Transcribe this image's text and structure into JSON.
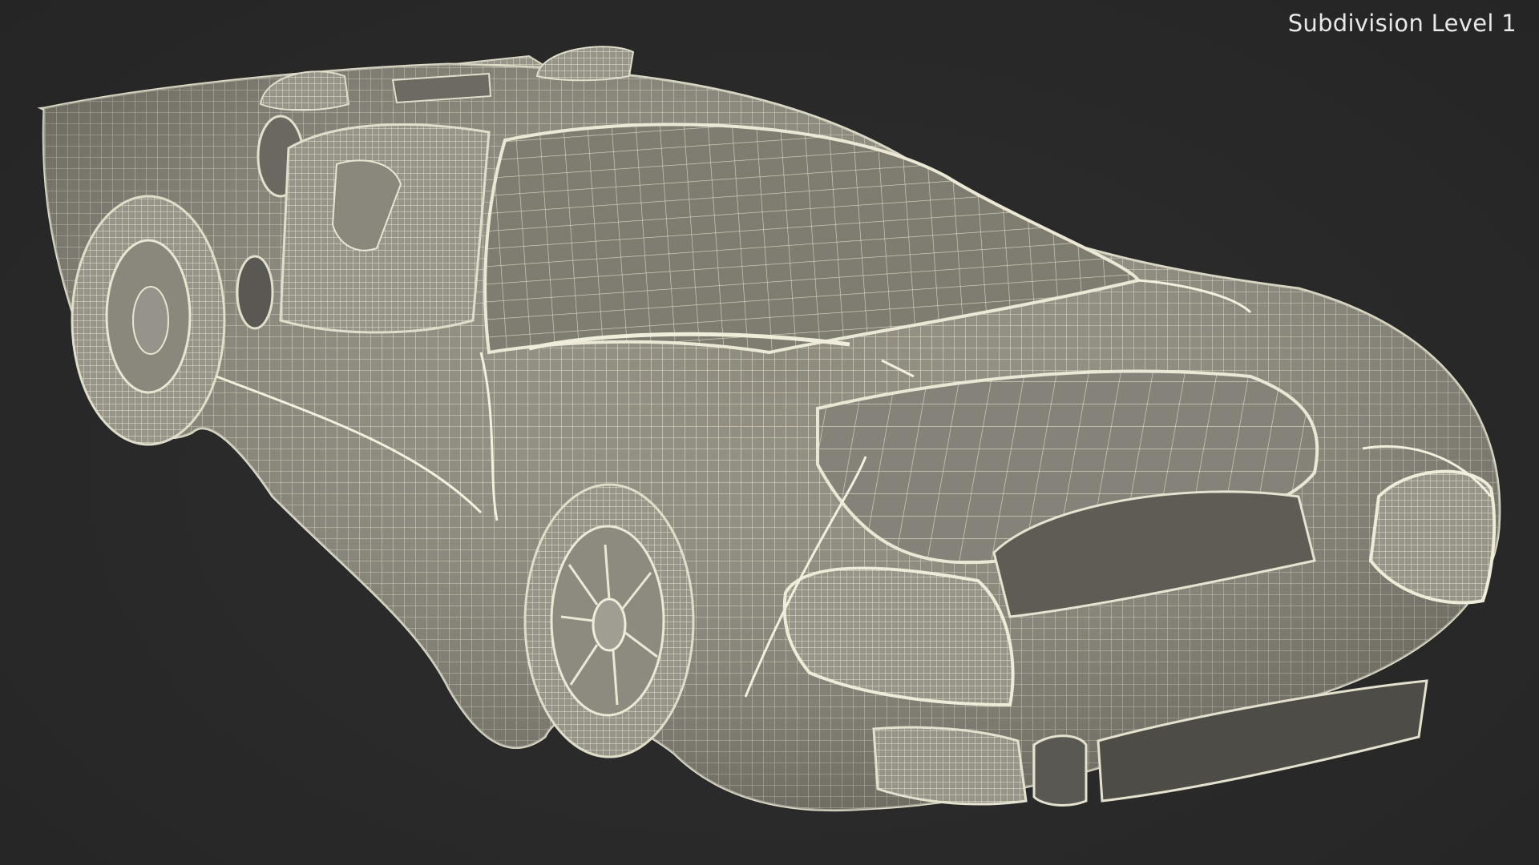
{
  "viewport": {
    "subdivision_label": "Subdivision Level 1",
    "background_color": "#2b2b2b",
    "mesh_color": "#8f8c7f",
    "wire_color": "#e6e3cf"
  },
  "model": {
    "icon": "sports-car-wireframe"
  }
}
